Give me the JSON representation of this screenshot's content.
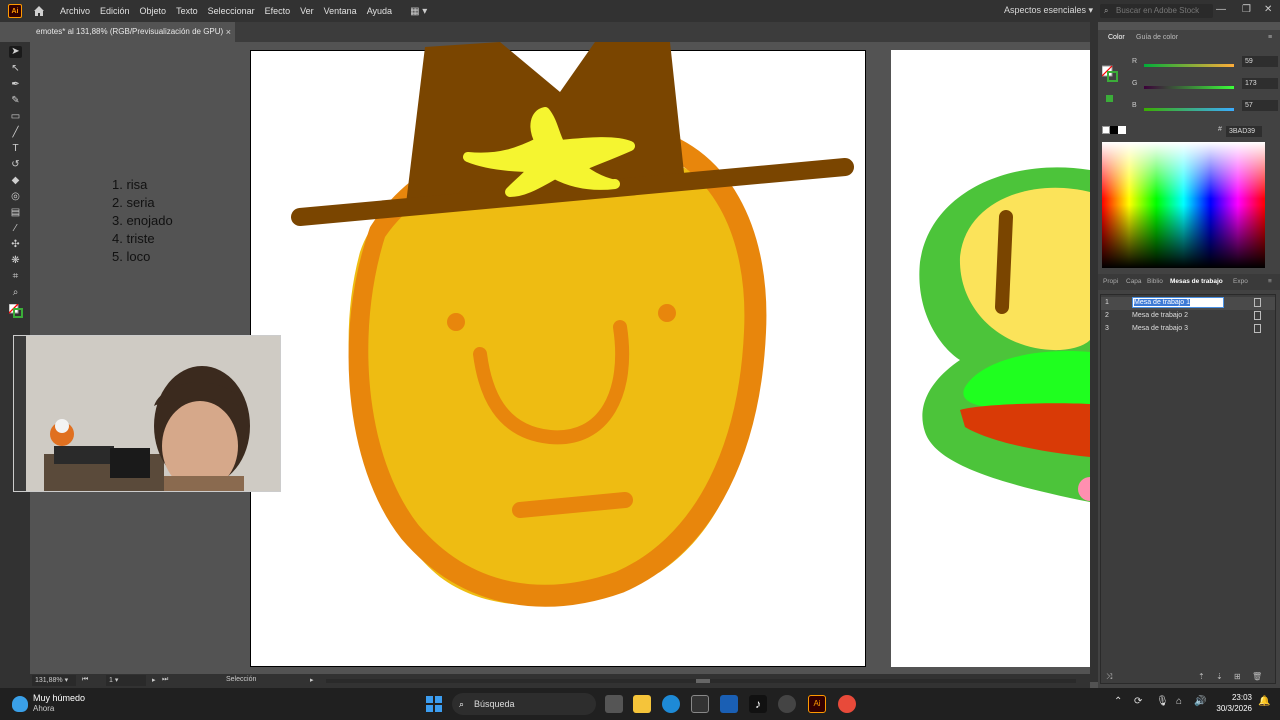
{
  "menubar": {
    "app_logo": "Ai",
    "items": [
      "Archivo",
      "Edición",
      "Objeto",
      "Texto",
      "Seleccionar",
      "Efecto",
      "Ver",
      "Ventana",
      "Ayuda"
    ],
    "workspace": "Aspectos esenciales",
    "search_placeholder": "Buscar en Adobe Stock"
  },
  "document": {
    "tab_title": "emotes* al 131,88% (RGB/Previsualización de GPU)",
    "close": "×"
  },
  "canvas": {
    "note_lines": [
      "1. risa",
      "2. seria",
      "3. enojado",
      "4. triste",
      "5. loco"
    ]
  },
  "colors": {
    "hat": "#7a4500",
    "star": "#f5f530",
    "face_outer": "#e8860c",
    "face_inner": "#eebc12",
    "frog_green": "#4cc43a",
    "frog_eye": "#fbe35a",
    "frog_mouth": "#d93a06",
    "frog_bright": "#1fff1f"
  },
  "color_panel": {
    "tabs": [
      "Color",
      "Guía de color"
    ],
    "r_label": "R",
    "r_value": "59",
    "g_label": "G",
    "g_value": "173",
    "b_label": "B",
    "b_value": "57",
    "hex_label": "#",
    "hex_value": "3BAD39"
  },
  "artboards_panel": {
    "tabs": [
      "Propi",
      "Capa",
      "Biblio",
      "Mesas de trabajo",
      "Expo"
    ],
    "rows": [
      {
        "num": "1",
        "name": "Mesa de trabajo 1"
      },
      {
        "num": "2",
        "name": "Mesa de trabajo 2"
      },
      {
        "num": "3",
        "name": "Mesa de trabajo 3"
      }
    ]
  },
  "statusbar": {
    "zoom": "131,88%",
    "page": "1",
    "tool": "Selección"
  },
  "taskbar": {
    "weather_title": "Muy húmedo",
    "weather_sub": "Ahora",
    "search": "Búsqueda",
    "time": "23:03",
    "date": "30/3/2026"
  }
}
